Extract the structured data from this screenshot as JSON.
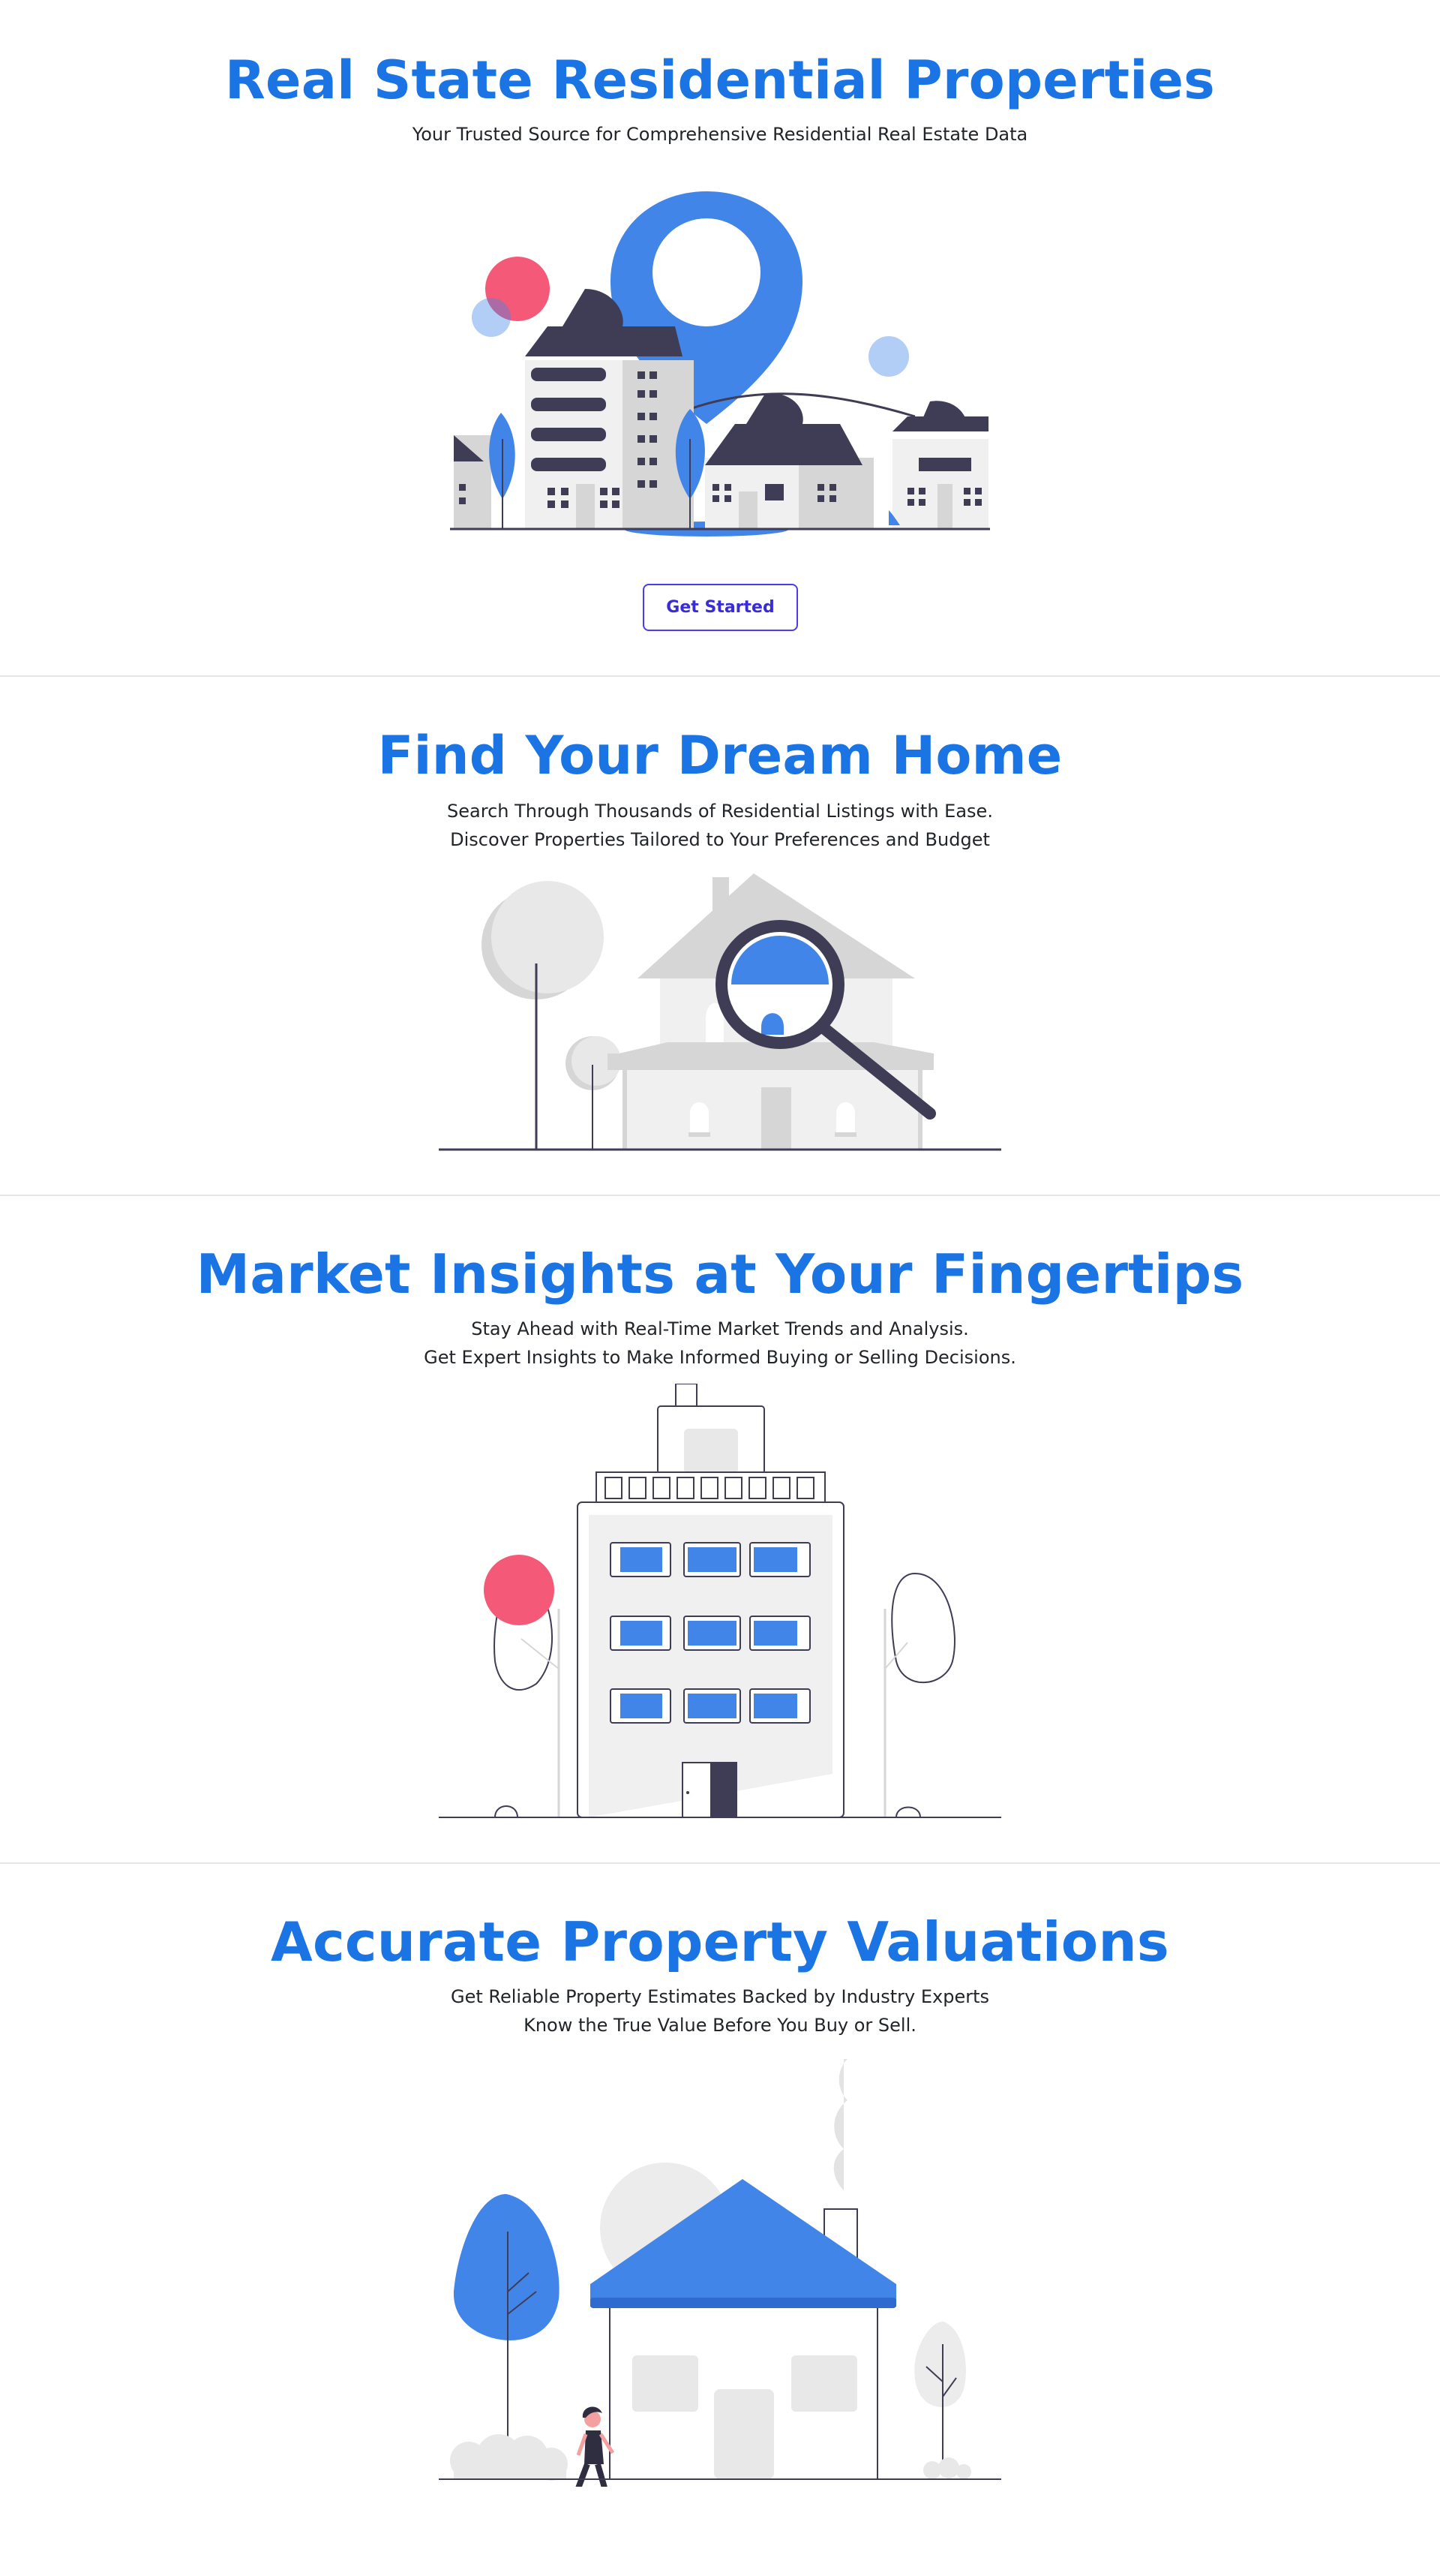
{
  "hero": {
    "title": "Real State Residential Properties",
    "subtitle": "Your Trusted Source for Comprehensive Residential Real Estate Data",
    "cta_label": "Get Started",
    "illustration": "city-buildings-with-map-pin"
  },
  "find_home": {
    "title": "Find Your Dream Home",
    "lines": [
      "Search Through Thousands of Residential Listings with Ease.",
      "Discover Properties Tailored to Your Preferences and Budget"
    ],
    "illustration": "house-with-magnifying-glass"
  },
  "market": {
    "title": "Market Insights at Your Fingertips",
    "lines": [
      "Stay Ahead with Real-Time Market Trends and Analysis.",
      "Get Expert Insights to Make Informed Buying or Selling Decisions."
    ],
    "illustration": "apartment-building"
  },
  "valuation": {
    "title": "Accurate Property Valuations",
    "lines": [
      "Get Reliable Property Estimates Backed by Industry Experts",
      "Know the True Value Before You Buy or Sell."
    ],
    "illustration": "person-walking-past-house"
  },
  "colors": {
    "primary_blue": "#1b74e4",
    "illustration_blue": "#4285e8",
    "accent_pink": "#f45a78",
    "dark": "#3f3d56",
    "button_border": "#4b3cf0"
  }
}
